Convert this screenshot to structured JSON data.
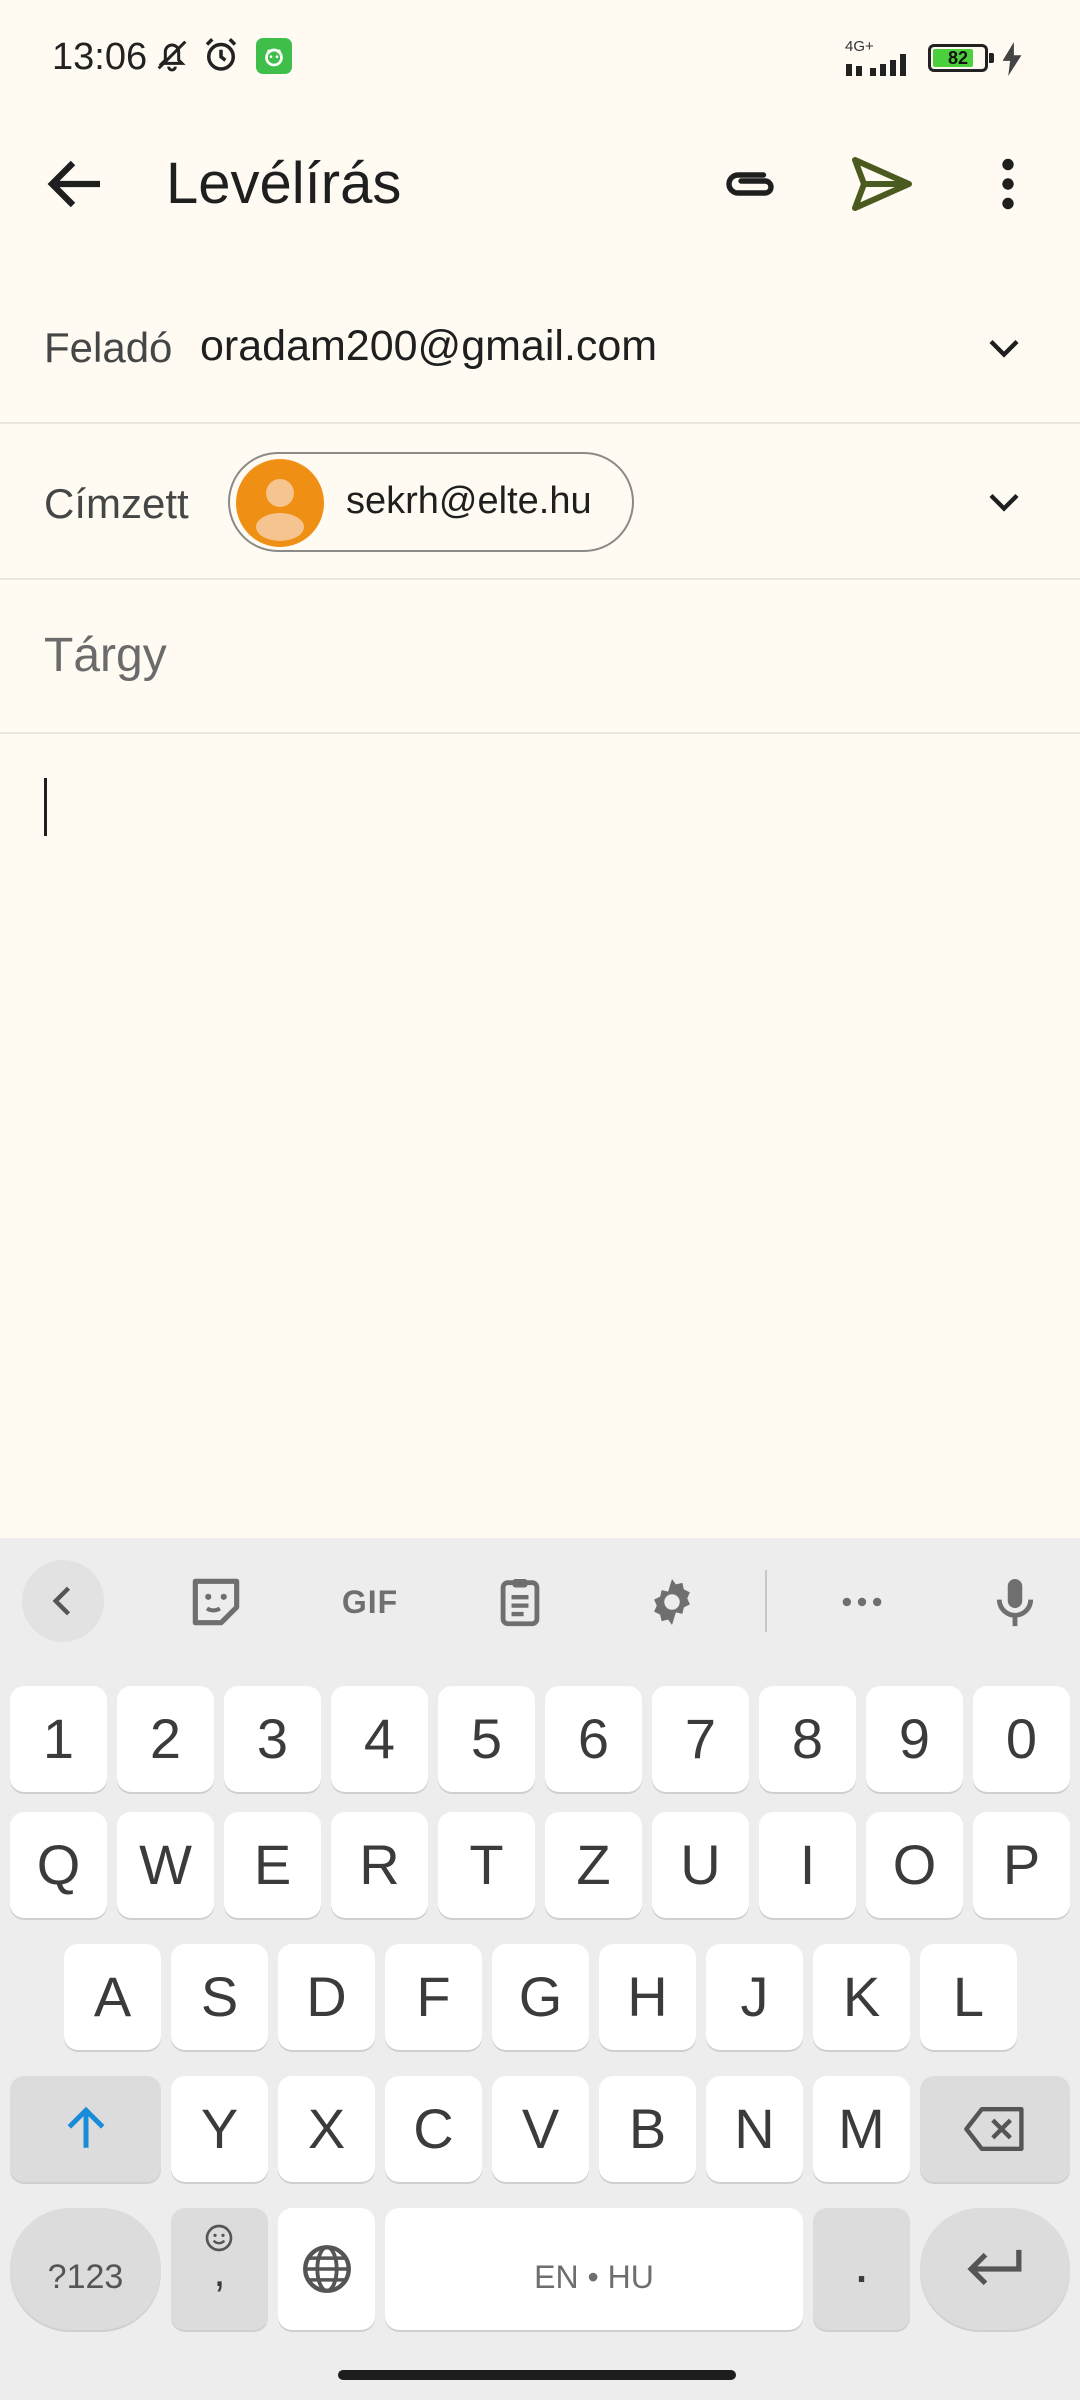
{
  "status_bar": {
    "time": "13:06",
    "network": "4G+",
    "battery": "82",
    "icons": [
      "mute-bell-icon",
      "alarm-icon",
      "app-notification-icon",
      "signal-icon",
      "battery-icon",
      "charging-icon"
    ]
  },
  "app_bar": {
    "title": "Levélírás",
    "icons": [
      "back-arrow-icon",
      "attachment-icon",
      "send-icon",
      "more-vert-icon"
    ],
    "send_color": "#4b5a1f"
  },
  "compose": {
    "from_label": "Feladó",
    "from_value": "oradam200@gmail.com",
    "to_label": "Címzett",
    "recipient_chip": "sekrh@elte.hu",
    "avatar_color": "#ef8f13",
    "subject_placeholder": "Tárgy"
  },
  "keyboard": {
    "toolbar": {
      "gif_label": "GIF",
      "icons": [
        "collapse-chevron-icon",
        "sticker-icon",
        "clipboard-icon",
        "settings-gear-icon",
        "more-horiz-icon",
        "microphone-icon"
      ]
    },
    "rows": {
      "numbers": [
        "1",
        "2",
        "3",
        "4",
        "5",
        "6",
        "7",
        "8",
        "9",
        "0"
      ],
      "row1": [
        "Q",
        "W",
        "E",
        "R",
        "T",
        "Z",
        "U",
        "I",
        "O",
        "P"
      ],
      "row2": [
        "A",
        "S",
        "D",
        "F",
        "G",
        "H",
        "J",
        "K",
        "L"
      ],
      "row3": [
        "Y",
        "X",
        "C",
        "V",
        "B",
        "N",
        "M"
      ]
    },
    "symbols_key": "?123",
    "comma_key": ",",
    "period_key": ".",
    "space_label": "EN • HU"
  }
}
